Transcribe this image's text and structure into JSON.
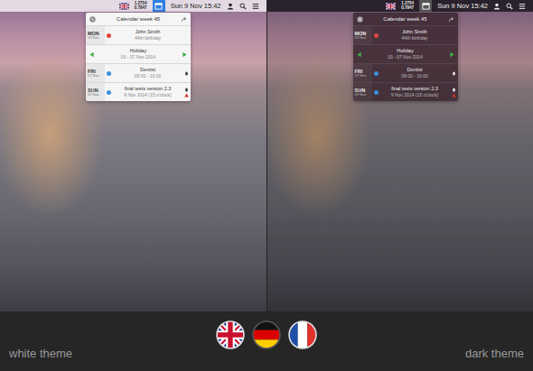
{
  "menu_bar": {
    "rates": [
      "1.2754",
      "0.7847"
    ],
    "clock": "Sun 9 Nov 15:42"
  },
  "popup": {
    "title": "Calendar week 45",
    "rows": [
      {
        "kind": "event",
        "day": "MON",
        "date": "03 Nov",
        "title": "John Smith",
        "detail": "44th birthday",
        "color": "#e0463c",
        "reminder": false,
        "overdue": false
      },
      {
        "kind": "span",
        "title": "Holiday",
        "detail": "03 - 07 Nov 2014",
        "color": "#3cb043"
      },
      {
        "kind": "event",
        "day": "FRI",
        "date": "07 Nov",
        "title": "Dentist",
        "detail": "09:00 - 10:00",
        "color": "#3a8fd9",
        "reminder": true,
        "overdue": false
      },
      {
        "kind": "event",
        "day": "SUN",
        "date": "09 Nov",
        "title": "final tests version 2.3",
        "detail": "9 Nov 2014 (15 o'clock)",
        "color": "#3a8fd9",
        "reminder": true,
        "overdue": true
      }
    ]
  },
  "themes": [
    {
      "label": "white theme",
      "kind": "light"
    },
    {
      "label": "dark theme",
      "kind": "dark"
    }
  ]
}
